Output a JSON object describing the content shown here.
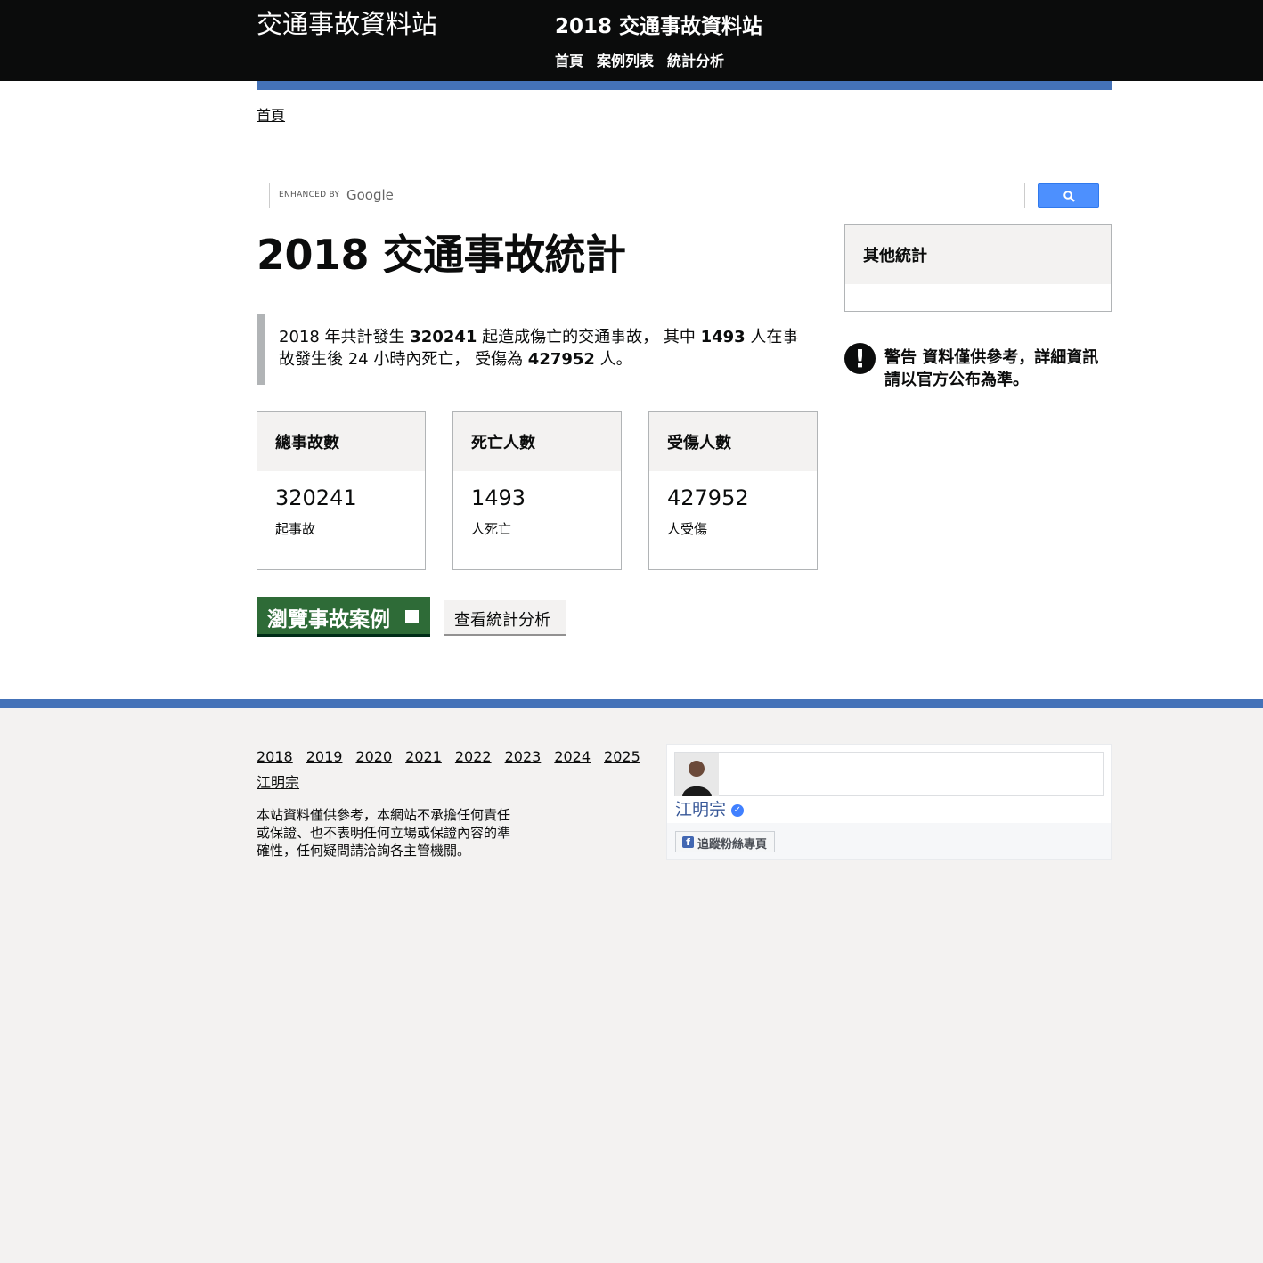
{
  "header": {
    "logo": "交通事故資料站",
    "service_name": "2018 交通事故資料站",
    "nav": [
      "首頁",
      "案例列表",
      "統計分析"
    ]
  },
  "breadcrumb": "首頁",
  "search": {
    "enhanced_by": "ENHANCED BY",
    "google": "Google"
  },
  "page_title": "2018 交通事故統計",
  "summary": {
    "part1": "2018 年共計發生 ",
    "accidents": "320241",
    "part2": " 起造成傷亡的交通事故， 其中 ",
    "deaths": "1493",
    "part3": " 人在事故發生後 24 小時內死亡， 受傷為 ",
    "injuries": "427952",
    "part4": " 人。"
  },
  "cards": [
    {
      "title": "總事故數",
      "value": "320241",
      "unit": "起事故"
    },
    {
      "title": "死亡人數",
      "value": "1493",
      "unit": "人死亡"
    },
    {
      "title": "受傷人數",
      "value": "427952",
      "unit": "人受傷"
    }
  ],
  "buttons": {
    "start": "瀏覽事故案例",
    "secondary": "查看統計分析"
  },
  "sidebar": {
    "title": "其他統計"
  },
  "warning": {
    "icon": "!",
    "text": "警告 資料僅供參考，詳細資訊請以官方公布為準。"
  },
  "footer": {
    "years": [
      "2018",
      "2019",
      "2020",
      "2021",
      "2022",
      "2023",
      "2024",
      "2025"
    ],
    "author": "江明宗",
    "disclaimer": "本站資料僅供參考，本網站不承擔任何責任或保證、也不表明任何立場或保證內容的準確性，任何疑問請洽詢各主管機關。"
  },
  "facebook": {
    "name": "江明宗",
    "follow": "追蹤粉絲專頁"
  },
  "colors": {
    "header": "#0b0c0c",
    "accent": "#4472b8",
    "start_button": "#2e6b37",
    "panel": "#f3f2f1"
  }
}
